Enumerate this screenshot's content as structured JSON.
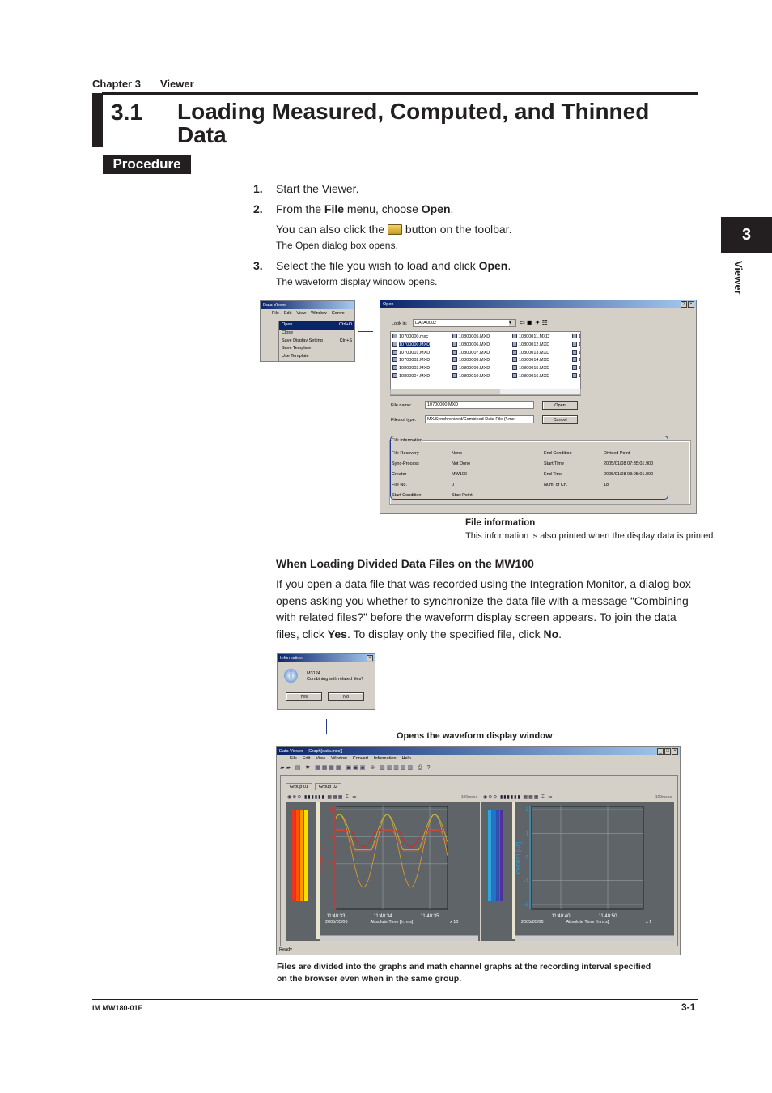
{
  "header": {
    "chapter": "Chapter 3",
    "chapter_title": "Viewer"
  },
  "section": {
    "number": "3.1",
    "title": "Loading Measured, Computed, and Thinned Data",
    "label": "Procedure"
  },
  "side_tab": {
    "number": "3",
    "label": "Viewer"
  },
  "steps": [
    {
      "n": "1.",
      "pre": "Start the Viewer.",
      "b1": "",
      "mid": "",
      "b2": "",
      "post": ""
    },
    {
      "n": "2.",
      "pre": "From the ",
      "b1": "File",
      "mid": " menu, choose ",
      "b2": "Open",
      "post": "."
    },
    {
      "n": "3.",
      "pre": "Select the file you wish to load and click ",
      "b1": "Open",
      "mid": "",
      "b2": "",
      "post": "."
    }
  ],
  "step2_alt": {
    "pre": "You can also click the",
    "post": "button on the toolbar.",
    "note": "The Open dialog box opens."
  },
  "step3_note": "The waveform display window opens.",
  "menu_shot": {
    "title": "Data Viewer",
    "menubar": [
      "File",
      "Edit",
      "View",
      "Window",
      "Conve"
    ],
    "items": [
      {
        "label": "Open...",
        "key": "Ctrl+O"
      },
      {
        "label": "Close",
        "key": ""
      },
      {
        "label": "Save Display Setting",
        "key": "Ctrl+S"
      },
      {
        "label": "Save Template",
        "key": ""
      },
      {
        "label": "Use Template",
        "key": ""
      }
    ]
  },
  "open_dialog": {
    "title": "Open",
    "look_in_label": "Look in:",
    "look_in": "DATA0002",
    "files": [
      "10700000.mxc",
      "10700000.MXD",
      "10700001.MXD",
      "10700002.MXD",
      "10800003.MXD",
      "10800004.MXD",
      "10800005.MXD",
      "10800006.MXD",
      "10800007.MXD",
      "10800008.MXD",
      "10800009.MXD",
      "10800010.MXD",
      "10800011.MXD",
      "10800012.MXD",
      "10800013.MXD",
      "10800014.MXD",
      "10800015.MXD",
      "10800016.MXD",
      "1",
      "1",
      "1",
      "1",
      "1",
      "1"
    ],
    "selected": "10700000.MXD",
    "file_name_label": "File name:",
    "file_name": "10700000.MXD",
    "type_label": "Files of type:",
    "type": "MX/Synchronized/Combined Data File (*.mx",
    "open": "Open",
    "cancel": "Cancel",
    "info_title": "File Information",
    "info": [
      [
        "File Recovery",
        "None",
        "End Condition",
        "Divided Point"
      ],
      [
        "Sync-Process",
        "Not Done",
        "Start Time",
        "2005/01/08 07:35:01.900"
      ],
      [
        "Creator",
        "MW100",
        "End Time",
        "2005/01/08 08:05:01.800"
      ],
      [
        "File No.",
        "0",
        "Num. of Ch.",
        "18"
      ],
      [
        "Start Condition",
        "Start Point",
        "",
        ""
      ]
    ]
  },
  "file_info_callout": {
    "title": "File information",
    "desc": "This information is also printed when the display data is printed"
  },
  "divided": {
    "heading": "When Loading Divided Data Files on the MW100",
    "p1": "If you open a data file that was recorded using the Integration Monitor, a dialog box opens asking you whether to synchronize the data file with a message “Combining with related files?” before the waveform display screen appears. To join the data files, click ",
    "yes": "Yes",
    "p2": ". To display only the specified file, click ",
    "no": "No",
    "p3": "."
  },
  "info_dialog": {
    "title": "Information",
    "code": "M3124",
    "message": "Combining with related files?",
    "yes": "Yes",
    "no": "No"
  },
  "opens_caption": "Opens the waveform display window",
  "viewer": {
    "title": "Data Viewer - [Graph[data.mxc]]",
    "menubar": [
      "File",
      "Edit",
      "View",
      "Window",
      "Convert",
      "Information",
      "Help"
    ],
    "tabs": [
      "Group 01",
      "Group 02"
    ],
    "status": "Ready",
    "left": {
      "interval": "100msec",
      "ylabel": "CH0001 [V]",
      "yticks": [
        "2",
        "0",
        "-2",
        "-4"
      ],
      "xticks": [
        "11:40:33",
        "11:40:34",
        "11:40:35"
      ],
      "date": "2005/05/06",
      "xlabel": "Absolute Time [h:m:s]",
      "zoom": "x 10"
    },
    "right": {
      "interval": "100msec",
      "ylabel": "CH0011 [uZ]",
      "yticks": [
        "2",
        "1",
        "0",
        "-1",
        "-2"
      ],
      "xticks": [
        "11:40:40",
        "11:40:50"
      ],
      "date": "2005/05/06",
      "xlabel": "Absolute Time [h:m:s]",
      "zoom": "x 1"
    }
  },
  "bottom_caption": [
    "Files are divided into the graphs and math channel graphs at the recording interval specified",
    "on the browser even when in the same group."
  ],
  "footer": {
    "doc_id": "IM MW180-01E",
    "page": "3-1"
  },
  "colors": {
    "titlebar": "#0a246a",
    "callout": "#2b3990",
    "plot_bg": "#5f6468",
    "left_axis": "#e0302a",
    "right_axis": "#29a8e0"
  }
}
